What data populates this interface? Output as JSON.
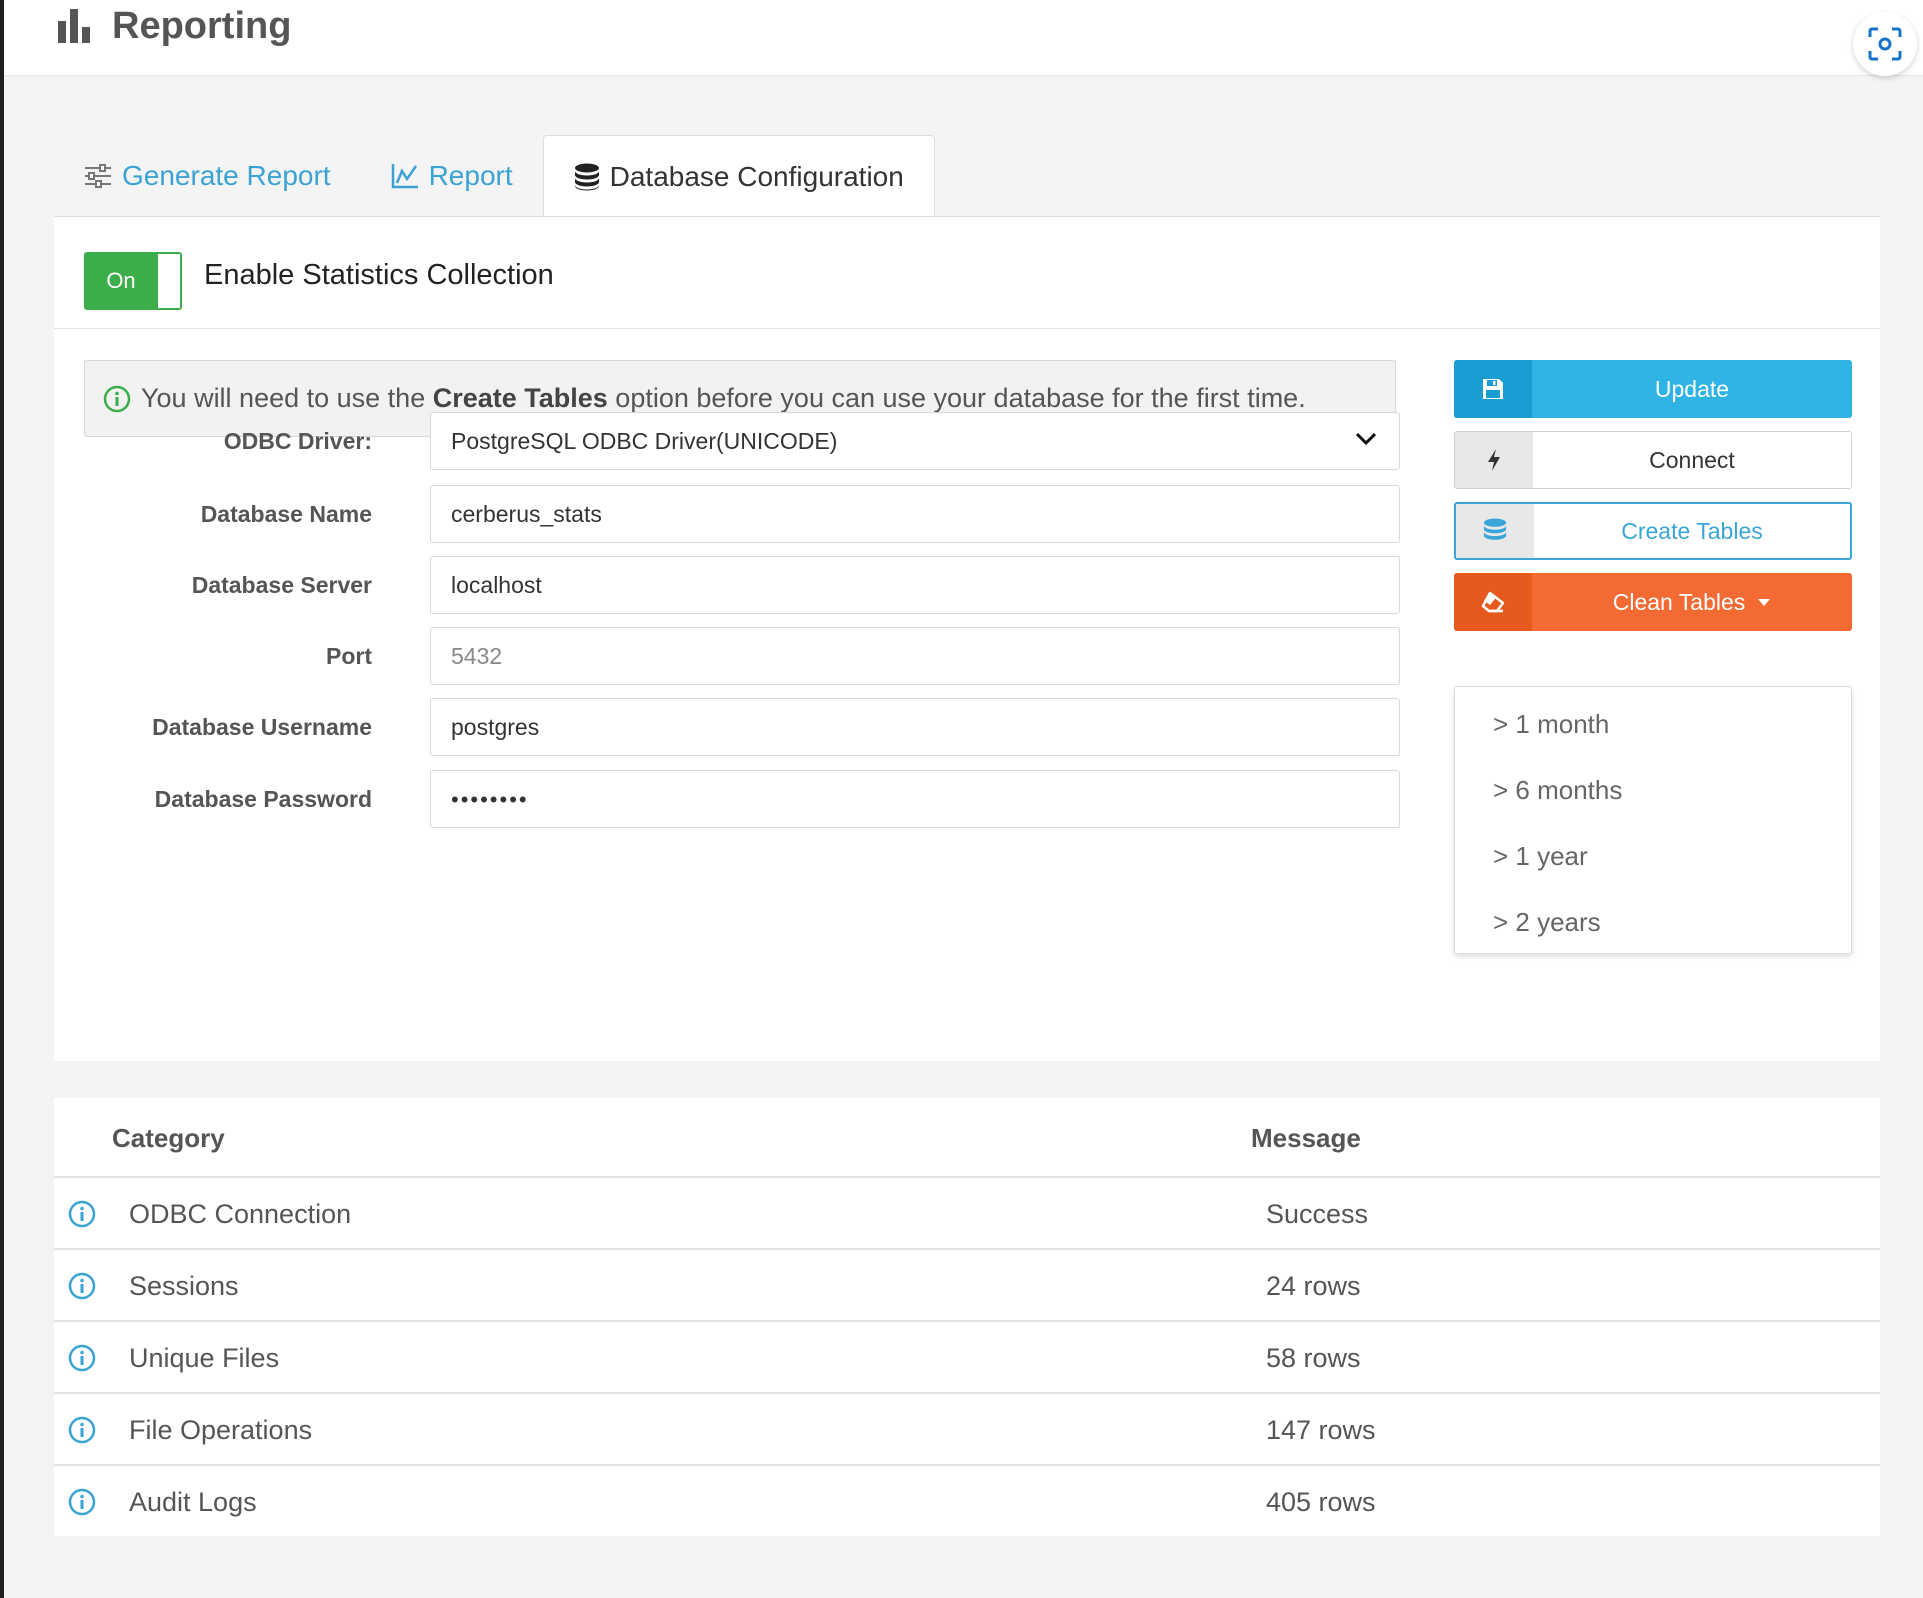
{
  "header": {
    "title": "Reporting",
    "icon": "bar-chart-icon",
    "screenshot_icon": "screenshot-icon"
  },
  "tabs": [
    {
      "label": "Generate Report",
      "icon": "sliders-icon",
      "active": false
    },
    {
      "label": "Report",
      "icon": "line-chart-icon",
      "active": false
    },
    {
      "label": "Database Configuration",
      "icon": "database-icon",
      "active": true
    }
  ],
  "statistics": {
    "toggle_state": "On",
    "label": "Enable Statistics Collection"
  },
  "alert": {
    "icon": "info-circle-icon",
    "text_before": "You will need to use the ",
    "text_bold": "Create Tables",
    "text_after": " option before you can use your database for the first time."
  },
  "form": {
    "odbc_driver_label": "ODBC Driver:",
    "odbc_driver_value": "PostgreSQL ODBC Driver(UNICODE)",
    "db_name_label": "Database Name",
    "db_name_value": "cerberus_stats",
    "db_server_label": "Database Server",
    "db_server_value": "localhost",
    "port_label": "Port",
    "port_placeholder": "5432",
    "db_user_label": "Database Username",
    "db_user_value": "postgres",
    "db_password_label": "Database Password",
    "db_password_mask": "••••••••"
  },
  "actions": {
    "update_label": "Update",
    "connect_label": "Connect",
    "create_tables_label": "Create Tables",
    "clean_tables_label": "Clean Tables",
    "clean_options": [
      "> 1 month",
      "> 6 months",
      "> 1 year",
      "> 2 years"
    ]
  },
  "results": {
    "headers": {
      "category": "Category",
      "message": "Message"
    },
    "rows": [
      {
        "category": "ODBC Connection",
        "message": "Success"
      },
      {
        "category": "Sessions",
        "message": "24 rows"
      },
      {
        "category": "Unique Files",
        "message": "58 rows"
      },
      {
        "category": "File Operations",
        "message": "147 rows"
      },
      {
        "category": "Audit Logs",
        "message": "405 rows"
      }
    ]
  },
  "colors": {
    "accent_blue": "#2fb3e5",
    "toggle_green": "#3cae49",
    "clean_orange": "#f36b33",
    "link_blue": "#3ba3d4"
  }
}
